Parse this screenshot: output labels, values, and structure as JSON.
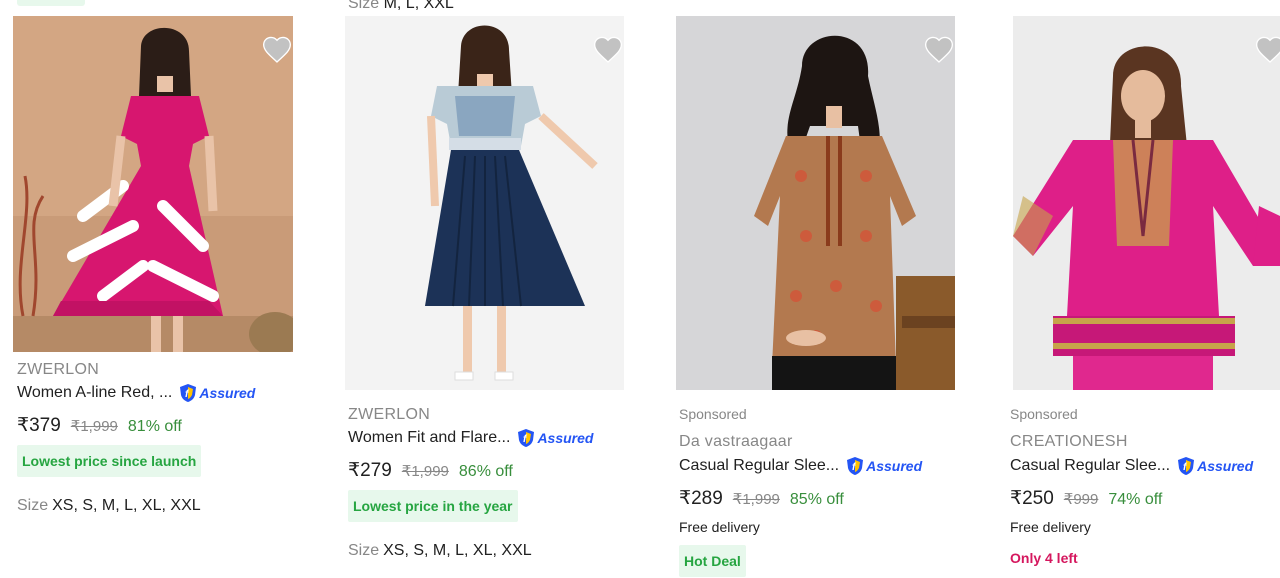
{
  "top": {
    "size_label": "Size",
    "size_values": "M, L, XXL"
  },
  "cards": [
    {
      "brand": "ZWERLON",
      "title": "Women A-line Red, ...",
      "assured": "Assured",
      "price": "₹379",
      "mrp": "₹1,999",
      "discount": "81% off",
      "tag": "Lowest price since launch",
      "size_label": "Size",
      "size_values": "XS, S, M, L, XL, XXL"
    },
    {
      "brand": "ZWERLON",
      "title": "Women Fit and Flare...",
      "assured": "Assured",
      "price": "₹279",
      "mrp": "₹1,999",
      "discount": "86% off",
      "tag": "Lowest price in the year",
      "size_label": "Size",
      "size_values": "XS, S, M, L, XL, XXL"
    },
    {
      "sponsored": "Sponsored",
      "brand": "Da vastraagaar",
      "title": "Casual Regular Slee...",
      "assured": "Assured",
      "price": "₹289",
      "mrp": "₹1,999",
      "discount": "85% off",
      "delivery": "Free delivery",
      "tag": "Hot Deal"
    },
    {
      "sponsored": "Sponsored",
      "brand": "CREATIONESH",
      "title": "Casual Regular Slee...",
      "assured": "Assured",
      "price": "₹250",
      "mrp": "₹999",
      "discount": "74% off",
      "delivery": "Free delivery",
      "stock": "Only 4 left"
    }
  ],
  "colors": {
    "discount": "#388e3c",
    "tag_bg": "#e7f8ec",
    "tag_text": "#26a541",
    "assured": "#2455f4",
    "stock": "#d5175e",
    "heart": "#c2c2c2"
  },
  "icons": {
    "wishlist": "heart-icon",
    "assured": "assured-shield-icon"
  }
}
